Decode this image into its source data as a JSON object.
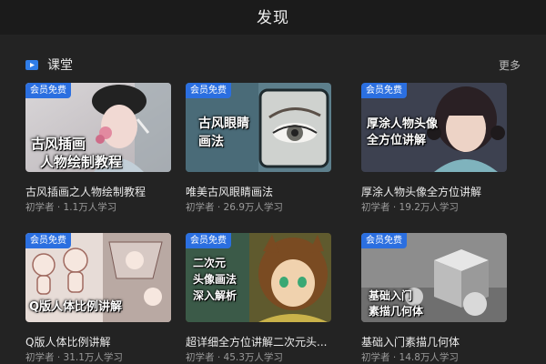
{
  "header": {
    "title": "发现"
  },
  "section": {
    "title": "课堂",
    "more_label": "更多",
    "icon": "play-icon"
  },
  "colors": {
    "accent": "#2b6fe0",
    "background": "#232323",
    "header_bg": "#1b1b1b"
  },
  "courses": [
    {
      "badge": "会员免费",
      "overlay_lines": [
        "古风插画",
        "人物绘制教程"
      ],
      "title": "古风插画之人物绘制教程",
      "meta": "初学者 · 1.1万人学习"
    },
    {
      "badge": "会员免费",
      "overlay_lines": [
        "古风眼睛",
        "画法"
      ],
      "title": "唯美古风眼睛画法",
      "meta": "初学者 · 26.9万人学习"
    },
    {
      "badge": "会员免费",
      "overlay_lines": [
        "厚涂人物头像",
        "全方位讲解"
      ],
      "title": "厚涂人物头像全方位讲解",
      "meta": "初学者 · 19.2万人学习"
    },
    {
      "badge": "会员免费",
      "overlay_lines": [
        "Q版人体比例讲解"
      ],
      "title": "Q版人体比例讲解",
      "meta": "初学者 · 31.1万人学习"
    },
    {
      "badge": "会员免费",
      "overlay_lines": [
        "二次元",
        "头像画法",
        "深入解析"
      ],
      "title": "超详细全方位讲解二次元头...",
      "meta": "初学者 · 45.3万人学习"
    },
    {
      "badge": "会员免费",
      "overlay_lines": [
        "基础入门",
        "素描几何体"
      ],
      "title": "基础入门素描几何体",
      "meta": "初学者 · 14.8万人学习"
    }
  ]
}
